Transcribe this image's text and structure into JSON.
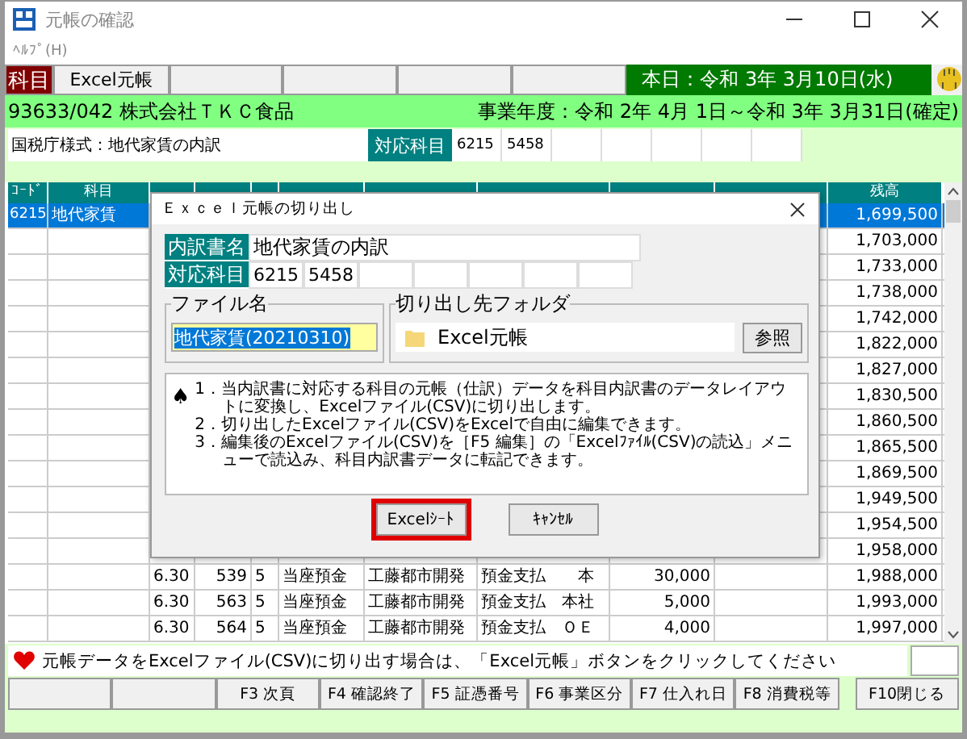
{
  "window": {
    "title": "元帳の確認"
  },
  "menu": [
    "ﾍﾙﾌﾟ(H)"
  ],
  "toolbar": {
    "tabs": [
      {
        "label": "科目",
        "selected": true
      },
      {
        "label": "Excel元帳",
        "selected": false
      }
    ],
    "today": "本日：令和 3年 3月10日(水)"
  },
  "company": {
    "name": "93633/042 株式会社ＴＫＣ食品",
    "fiscal_year": "事業年度：令和 2年 4月 1日～令和 3年 3月31日(確定)"
  },
  "form": {
    "label": "国税庁様式：地代家賃の内訳",
    "account_label": "対応科目",
    "codes": [
      "6215",
      "5458"
    ]
  },
  "table": {
    "columns": [
      {
        "label": "ｺｰﾄﾞ"
      },
      {
        "label": "科目"
      },
      {},
      {},
      {},
      {},
      {},
      {},
      {},
      {},
      {
        "label": "残高"
      }
    ],
    "rows": [
      {
        "selected": true,
        "cells": [
          "6215",
          "地代家賃",
          "",
          "",
          "",
          "",
          "",
          "",
          "",
          "",
          "1,699,500"
        ]
      },
      {
        "selected": false,
        "cells": [
          "",
          "",
          "",
          "",
          "",
          "",
          "",
          "",
          "",
          "",
          "1,703,000"
        ]
      },
      {
        "selected": false,
        "cells": [
          "",
          "",
          "",
          "",
          "",
          "",
          "",
          "",
          "",
          "",
          "1,733,000"
        ]
      },
      {
        "selected": false,
        "cells": [
          "",
          "",
          "",
          "",
          "",
          "",
          "",
          "",
          "",
          "",
          "1,738,000"
        ]
      },
      {
        "selected": false,
        "cells": [
          "",
          "",
          "",
          "",
          "",
          "",
          "",
          "",
          "",
          "",
          "1,742,000"
        ]
      },
      {
        "selected": false,
        "cells": [
          "",
          "",
          "",
          "",
          "",
          "",
          "",
          "",
          "",
          "",
          "1,822,000"
        ]
      },
      {
        "selected": false,
        "cells": [
          "",
          "",
          "",
          "",
          "",
          "",
          "",
          "",
          "",
          "",
          "1,827,000"
        ]
      },
      {
        "selected": false,
        "cells": [
          "",
          "",
          "",
          "",
          "",
          "",
          "",
          "",
          "",
          "",
          "1,830,500"
        ]
      },
      {
        "selected": false,
        "cells": [
          "",
          "",
          "",
          "",
          "",
          "",
          "",
          "",
          "",
          "",
          "1,860,500"
        ]
      },
      {
        "selected": false,
        "cells": [
          "",
          "",
          "",
          "",
          "",
          "",
          "",
          "",
          "",
          "",
          "1,865,500"
        ]
      },
      {
        "selected": false,
        "cells": [
          "",
          "",
          "",
          "",
          "",
          "",
          "",
          "",
          "",
          "",
          "1,869,500"
        ]
      },
      {
        "selected": false,
        "cells": [
          "",
          "",
          "",
          "",
          "",
          "",
          "",
          "",
          "",
          "",
          "1,949,500"
        ]
      },
      {
        "selected": false,
        "cells": [
          "",
          "",
          "",
          "",
          "",
          "",
          "",
          "",
          "",
          "",
          "1,954,500"
        ]
      },
      {
        "selected": false,
        "cells": [
          "",
          "",
          "",
          "",
          "",
          "",
          "",
          "",
          "",
          "",
          "1,958,000"
        ]
      },
      {
        "selected": false,
        "cells": [
          "",
          "",
          "6.30",
          "539",
          "5",
          "当座預金",
          "工藤都市開発",
          "預金支払　　本",
          "30,000",
          "",
          "1,988,000"
        ]
      },
      {
        "selected": false,
        "cells": [
          "",
          "",
          "6.30",
          "563",
          "5",
          "当座預金",
          "工藤都市開発",
          "預金支払　本社",
          "5,000",
          "",
          "1,993,000"
        ]
      },
      {
        "selected": false,
        "cells": [
          "",
          "",
          "6.30",
          "564",
          "5",
          "当座預金",
          "工藤都市開発",
          "預金支払　ＯＥ",
          "4,000",
          "",
          "1,997,000"
        ]
      }
    ]
  },
  "message": "元帳データをExcelファイル(CSV)に切り出す場合は、「Excel元帳」ボタンをクリックしてください",
  "function_keys": [
    {
      "label": "F3 次頁"
    },
    {
      "label": "F4 確認終了"
    },
    {
      "label": "F5 証憑番号"
    },
    {
      "label": "F6 事業区分"
    },
    {
      "label": "F7 仕入れ日"
    },
    {
      "label": "F8 消費税等"
    },
    {
      "label": "F10閉じる"
    }
  ],
  "dialog": {
    "title": "Ｅｘｃｅｌ元帳の切り出し",
    "statement_label": "内訳書名",
    "statement_name": "地代家賃の内訳",
    "account_label": "対応科目",
    "codes": [
      "6215",
      "5458"
    ],
    "file_label": "ファイル名",
    "file_name": "地代家賃(20210310)",
    "folder_label": "切り出し先フォルダ",
    "folder": "Excel元帳",
    "browse": "参照",
    "notes_mark": "♠",
    "notes": [
      "1．当内訳書に対応する科目の元帳（仕訳）データを科目内訳書のデータレイアウトに変換し、Excelファイル(CSV)に切り出します。",
      "2．切り出したExcelファイル(CSV)をExcelで自由に編集できます。",
      "3．編集後のExcelファイル(CSV)を［F5 編集］の「Excelﾌｧｲﾙ(CSV)の読込」メニューで読込み、科目内訳書データに転記できます。"
    ],
    "buttons": [
      {
        "label": "Excelｼｰﾄ",
        "focused": true
      },
      {
        "label": "ｷｬﾝｾﾙ",
        "focused": false
      }
    ]
  }
}
